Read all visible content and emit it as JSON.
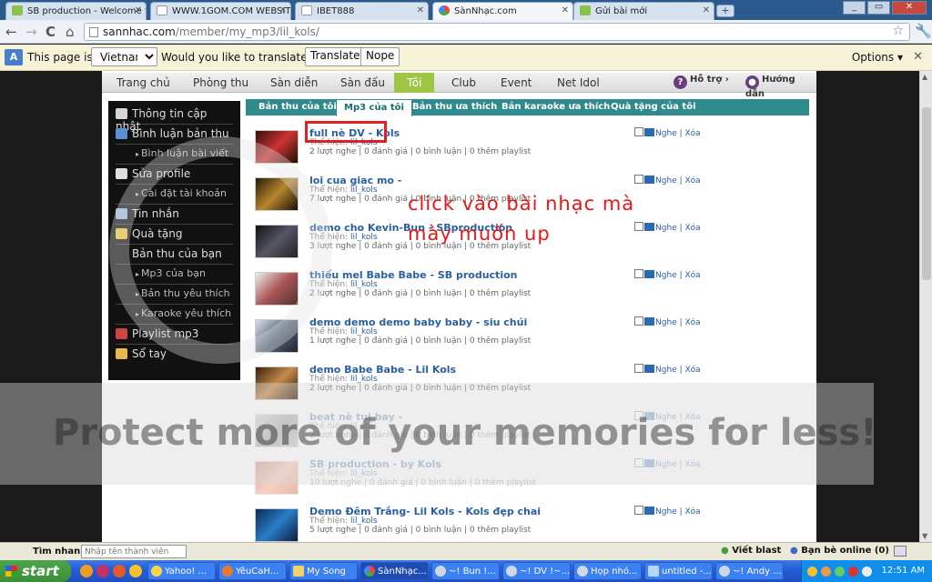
{
  "browser": {
    "tabs": [
      {
        "label": "SB production - Welcome t...",
        "icon": "chat-bubble-icon",
        "active": false
      },
      {
        "label": "WWW.1GOM.COM WEBSIT...",
        "icon": "page-icon",
        "active": false
      },
      {
        "label": "IBET888",
        "icon": "page-icon",
        "active": false
      },
      {
        "label": "SànNhạc.com",
        "icon": "flower-icon",
        "active": true
      },
      {
        "label": "Gửi bài mới",
        "icon": "chat-bubble-icon",
        "active": false
      }
    ],
    "new_tab_label": "+",
    "window_buttons": {
      "minimize": "_",
      "restore": "▭",
      "close": "✕"
    },
    "nav": {
      "back": "←",
      "forward": "→",
      "reload": "C",
      "home": "⌂"
    },
    "url_domain": "sannhac.com",
    "url_path": "/member/my_mp3/lil_kols/",
    "menu_icon": "🔧"
  },
  "translate_bar": {
    "prefix": "This page is in",
    "language": "Vietnamese",
    "question": "Would you like to translate it?",
    "translate_button": "Translate",
    "nope_button": "Nope",
    "options": "Options ▾",
    "close": "✕"
  },
  "site": {
    "menu": [
      "Trang chủ",
      "Phòng thu",
      "Sàn diễn",
      "Sàn đấu",
      "Tôi",
      "Club",
      "Event",
      "Net Idol"
    ],
    "active_menu": "Tôi",
    "help_links": [
      "Hỗ trợ",
      "Hướng dẫn"
    ],
    "sidebar": [
      {
        "label": "Thông tin cập nhật",
        "type": "main",
        "icon": "home-icon"
      },
      {
        "label": "Bình luận bản thu",
        "type": "main",
        "icon": "comment-icon"
      },
      {
        "label": "Bình luận bài viết",
        "type": "sub"
      },
      {
        "label": "Sửa profile",
        "type": "main",
        "icon": "id-card-icon"
      },
      {
        "label": "Cài đặt tài khoản",
        "type": "sub"
      },
      {
        "label": "Tin nhắn",
        "type": "main",
        "icon": "mail-icon"
      },
      {
        "label": "Quà tặng",
        "type": "main",
        "icon": "gift-icon"
      },
      {
        "label": "Bản thu của bạn",
        "type": "plain"
      },
      {
        "label": "Mp3 của bạn",
        "type": "sub"
      },
      {
        "label": "Bản thu yêu thích",
        "type": "sub"
      },
      {
        "label": "Karaoke yêu thích",
        "type": "sub"
      },
      {
        "label": "Playlist mp3",
        "type": "main",
        "icon": "playlist-icon"
      },
      {
        "label": "Sổ tay",
        "type": "main",
        "icon": "pencil-icon"
      }
    ],
    "content_tabs": [
      "Bản thu của tôi",
      "Mp3 của tôi",
      "Bản thu ưa thích",
      "Bản karaoke ưa thích",
      "Quà tặng của tôi"
    ],
    "active_content_tab": "Mp3 của tôi",
    "songs": [
      {
        "title": "full nè DV - Kols",
        "artist_prefix": "Thể hiện:",
        "artist": "lil_kols",
        "stats": "2 lượt nghe | 0 đánh giá | 0 bình luận | 0 thêm playlist"
      },
      {
        "title": "loi cua giac mo -",
        "artist_prefix": "Thể hiện:",
        "artist": "lil_kols",
        "stats": "7 lượt nghe | 0 đánh giá | 0 bình luận | 0 thêm playlist"
      },
      {
        "title": "demo cho Kevin-Bun - SBproduction",
        "artist_prefix": "Thể hiện:",
        "artist": "lil_kols",
        "stats": "3 lượt nghe | 0 đánh giá | 0 bình luận | 0 thêm playlist"
      },
      {
        "title": "thiếu mel Babe Babe - SB production",
        "artist_prefix": "Thể hiện:",
        "artist": "lil_kols",
        "stats": "2 lượt nghe | 0 đánh giá | 0 bình luận | 0 thêm playlist"
      },
      {
        "title": "demo demo demo baby baby - siu chúi",
        "artist_prefix": "Thể hiện:",
        "artist": "lil_kols",
        "stats": "1 lượt nghe | 0 đánh giá | 0 bình luận | 0 thêm playlist"
      },
      {
        "title": "demo Babe Babe - Lil Kols",
        "artist_prefix": "Thể hiện:",
        "artist": "lil_kols",
        "stats": "2 lượt nghe | 0 đánh giá | 0 bình luận | 0 thêm playlist"
      },
      {
        "title": "beat nè tụi bay -",
        "artist_prefix": "Thể hiện:",
        "artist": "lil_kols",
        "stats": "2 lượt nghe | 0 đánh giá | 0 bình luận | 0 thêm playlist"
      },
      {
        "title": "SB production - by Kols",
        "artist_prefix": "Thể hiện:",
        "artist": "lil_kols",
        "stats": "10 lượt nghe | 0 đánh giá | 0 bình luận | 0 thêm playlist"
      },
      {
        "title": "Demo Đêm Trắng- Lil Kols - Kols đẹp chai",
        "artist_prefix": "Thể hiện:",
        "artist": "lil_kols",
        "stats": "5 lượt nghe | 0 đánh giá | 0 bình luận | 0 thêm playlist"
      }
    ],
    "action_listen": "Nghe",
    "action_separator": "|",
    "action_delete": "Xóa"
  },
  "annotation": {
    "line1": "click vào bài nhạc mà",
    "line2": "mày muốn up",
    "color": "#e41818"
  },
  "watermark": {
    "text": "Protect more of your memories for less!"
  },
  "status_bar": {
    "search_label": "Tìm nhanh:",
    "search_placeholder": "Nhập tên thành viên",
    "write_blast": "Viết blast",
    "friends_online": "Bạn bè online (0)"
  },
  "taskbar": {
    "start": "start",
    "items": [
      {
        "label": "Yahoo! ...",
        "active": false
      },
      {
        "label": "YêuCaH...",
        "active": false
      },
      {
        "label": "My Song",
        "active": false
      },
      {
        "label": "SànNhạc...",
        "active": true
      },
      {
        "label": "~! Bun !...",
        "active": false
      },
      {
        "label": "~! DV !~...",
        "active": false
      },
      {
        "label": "Họp nhó...",
        "active": false
      },
      {
        "label": "untitled -...",
        "active": false
      },
      {
        "label": "~! Andy ...",
        "active": false
      }
    ],
    "clock": "12:51 AM"
  }
}
